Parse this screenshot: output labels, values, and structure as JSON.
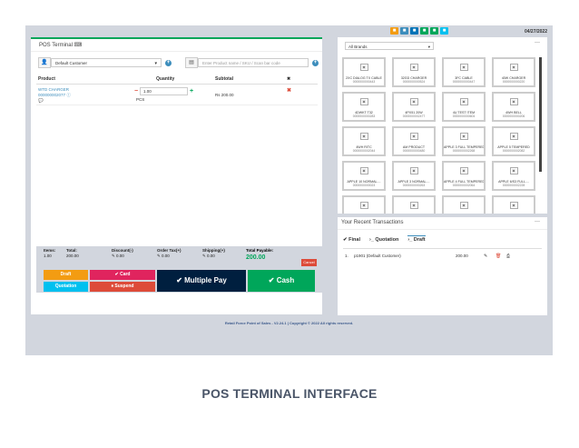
{
  "topbar": {
    "date": "04/27/2022",
    "icons": [
      {
        "name": "orange",
        "color": "#f39c12"
      },
      {
        "name": "blue1",
        "color": "#3c8dbc"
      },
      {
        "name": "blue2",
        "color": "#0073b7"
      },
      {
        "name": "green1",
        "color": "#00a65a"
      },
      {
        "name": "green2",
        "color": "#00a65a"
      },
      {
        "name": "lightblue",
        "color": "#00c0ef"
      }
    ]
  },
  "pos": {
    "title": "POS Terminal",
    "customer": "Default Customer",
    "search_placeholder": "Enter Product name / SKU / Scan bar code",
    "columns": [
      "Product",
      "Quantity",
      "Subtotal",
      "✖"
    ],
    "item": {
      "name": "WTD CHARGER",
      "code": "000000002077",
      "qty": "1.00",
      "unit": "PCS",
      "subtotal": "Rs 200.00"
    },
    "totals": {
      "items_label": "Items:",
      "items_value": "1.00",
      "total_label": "Total:",
      "total_value": "200.00",
      "discount_label": "Discount(-)",
      "discount_value": "0.00",
      "ordertax_label": "Order Tax(+)",
      "ordertax_value": "0.00",
      "shipping_label": "Shipping(+)",
      "shipping_value": "0.00",
      "payable_label": "Total Payable:",
      "payable_value": "200.00",
      "cancel": "Cancel"
    },
    "buttons": {
      "draft": "Draft",
      "card": "Card",
      "quotation": "Quotation",
      "suspend": "Suspend",
      "multiple": "Multiple Pay",
      "cash": "Cash"
    }
  },
  "brands": {
    "select": "All Brands",
    "products": [
      {
        "name": "2XC DIALOG TX CABLE",
        "code": "0000000000443"
      },
      {
        "name": "32GD CHARGER",
        "code": "0000000000524"
      },
      {
        "name": "3FC CABLE",
        "code": "0000000000447"
      },
      {
        "name": "40W CHARGER",
        "code": "0000000000220"
      },
      {
        "name": "4DWKT T32",
        "code": "0000000000283"
      },
      {
        "name": "4PX51 20W",
        "code": "0000000002477"
      },
      {
        "name": "4U TEST ITEM",
        "code": "0000000000604"
      },
      {
        "name": "4WH BELL",
        "code": "0000000000206"
      },
      {
        "name": "4WH RITC",
        "code": "0000000002044"
      },
      {
        "name": "AM PRODUCT",
        "code": "0000000000480"
      },
      {
        "name": "APPLE 3 FULL TEMPERED",
        "code": "0000000002268"
      },
      {
        "name": "APPLE 5 TEMPERED",
        "code": "0000000002082"
      },
      {
        "name": "APPLE 10 NORMAL....",
        "code": "0000000000023"
      },
      {
        "name": "APPLE 3 NORMAL....",
        "code": "0000000000263"
      },
      {
        "name": "APPLE 4 FULL TEMPERED",
        "code": "0000000002064"
      },
      {
        "name": "APPLE 6/S3 FULL....",
        "code": "0000000002228"
      },
      {
        "name": "",
        "code": ""
      },
      {
        "name": "",
        "code": ""
      },
      {
        "name": "",
        "code": ""
      },
      {
        "name": "",
        "code": ""
      }
    ]
  },
  "transactions": {
    "title": "Your Recent Transactions",
    "tabs": [
      "Final",
      "Quotation",
      "Draft"
    ],
    "row": {
      "num": "1.",
      "ref": "p1901 (Default Customer)",
      "amount": "200.00"
    }
  },
  "footer": "Retail Force Point of Sales - V2.24.1 | Copyright © 2022 All rights reserved.",
  "caption": "POS TERMINAL INTERFACE"
}
